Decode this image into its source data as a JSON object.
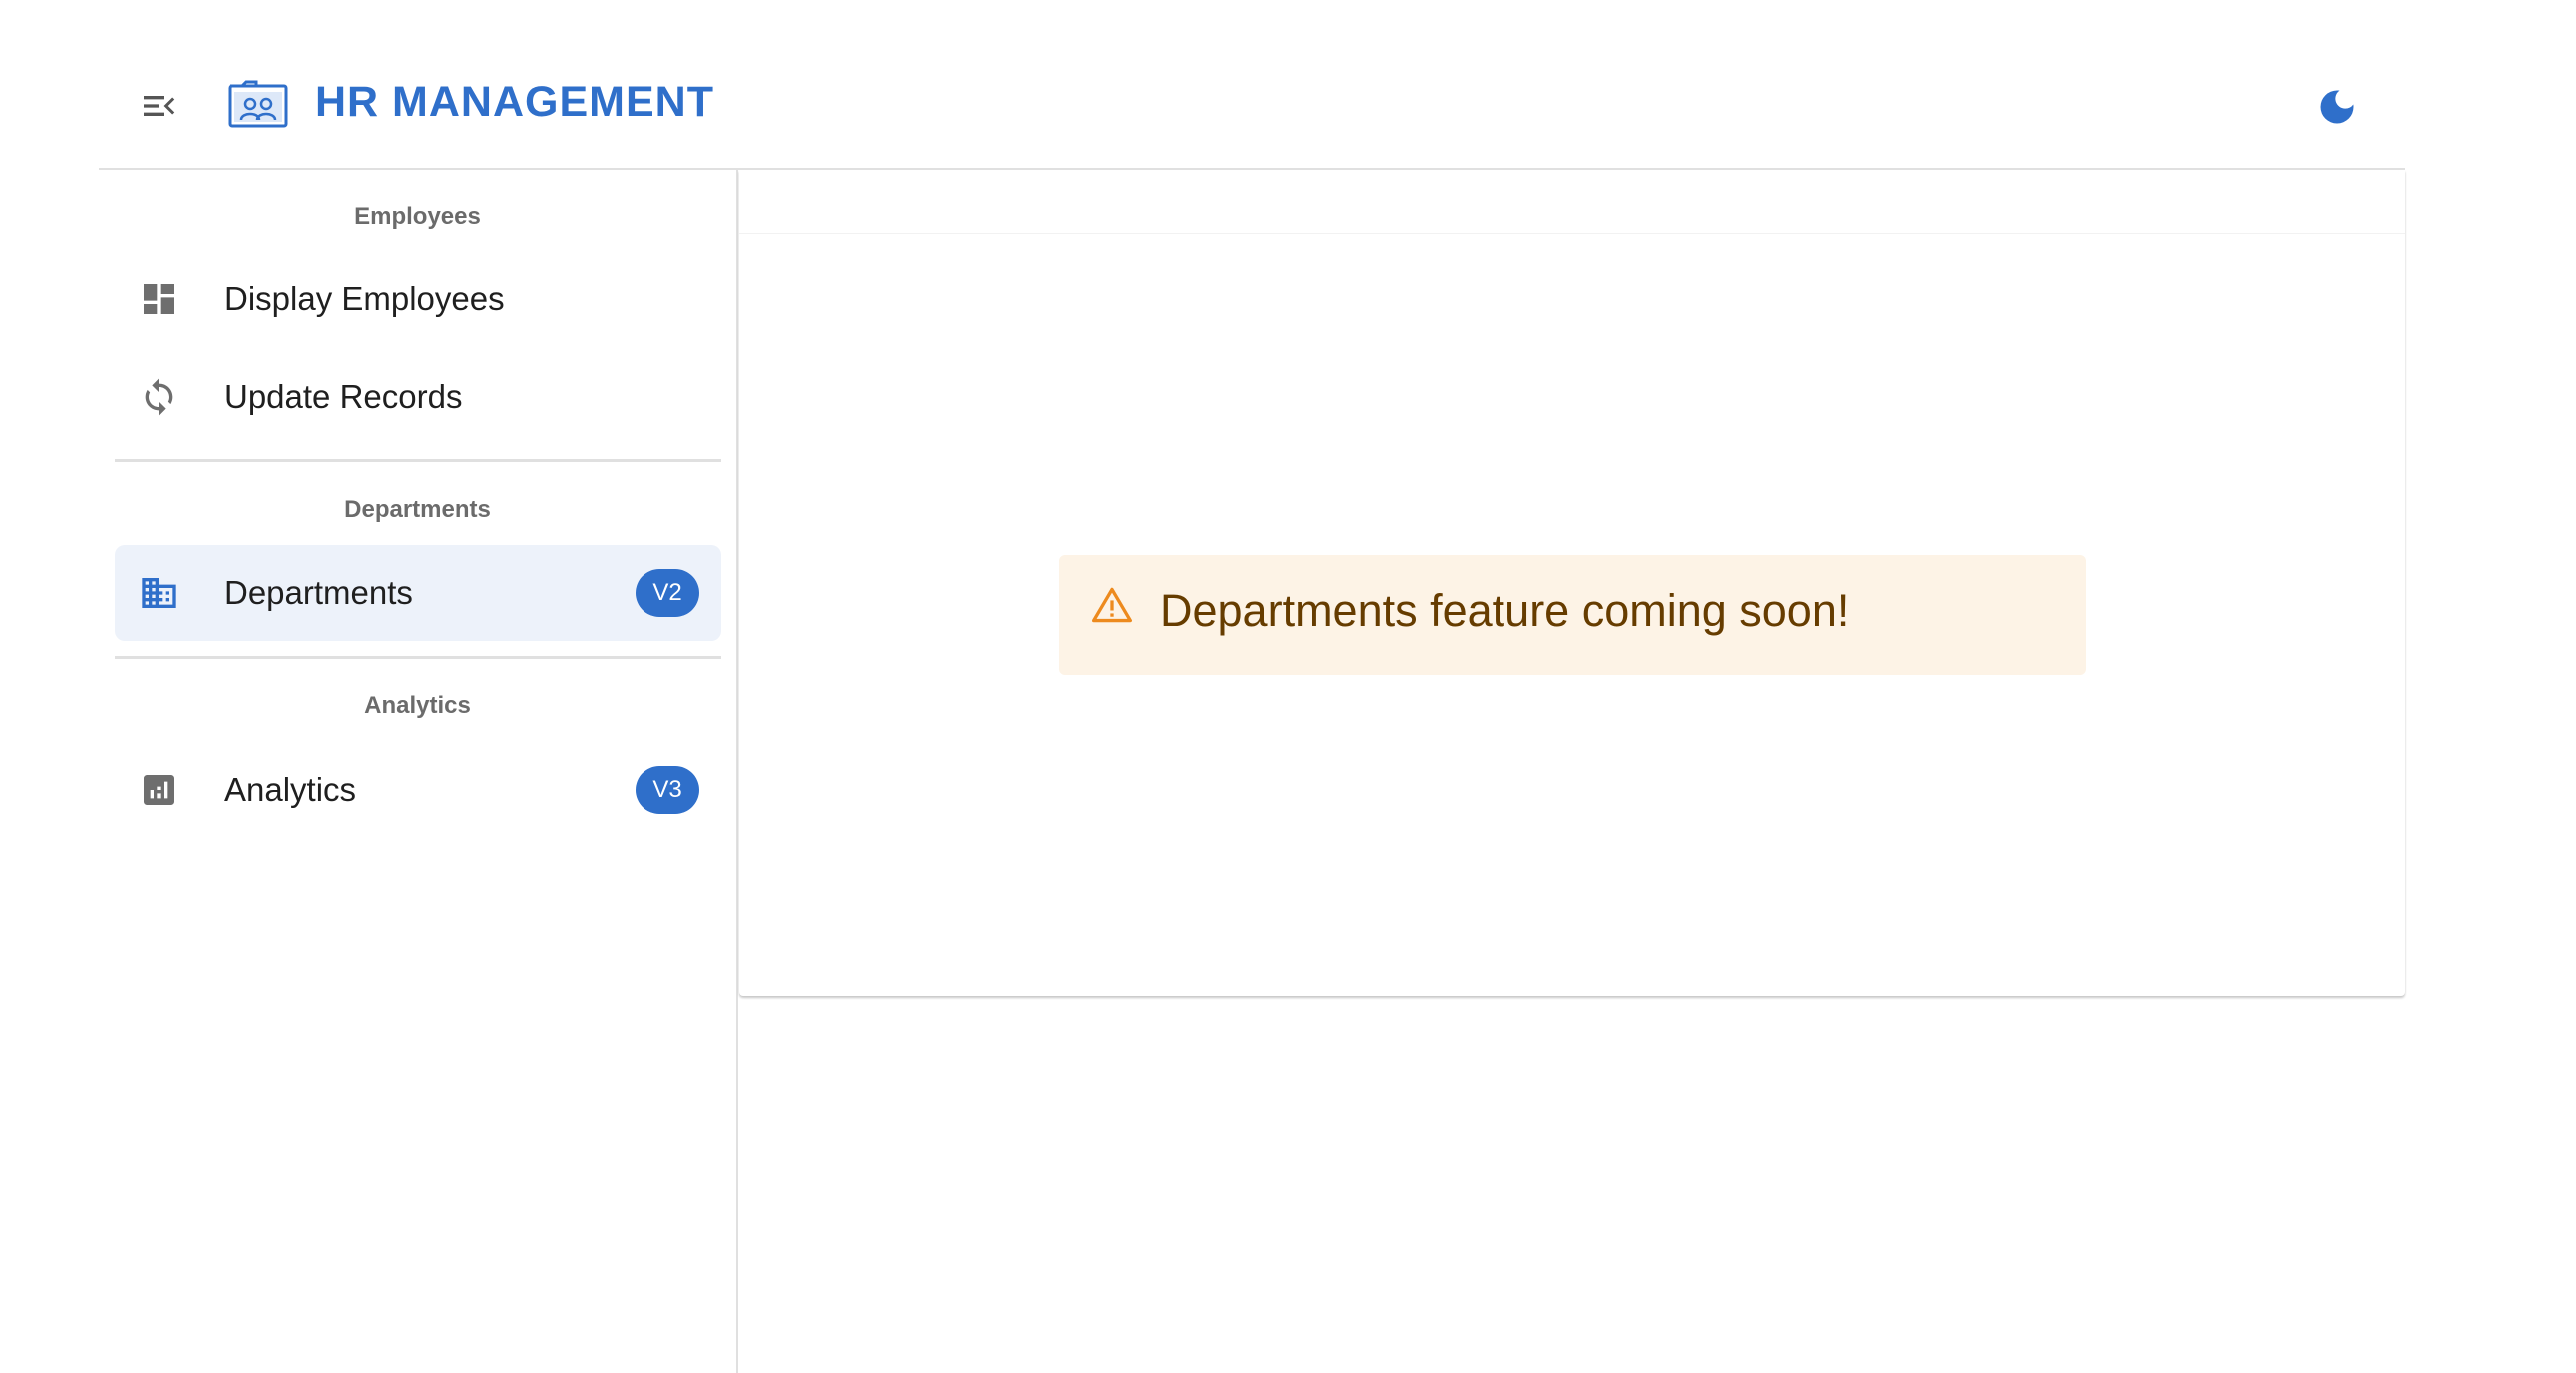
{
  "header": {
    "title": "HR MANAGEMENT",
    "menu_icon": "menu-collapse-icon",
    "logo_icon": "hr-logo-icon",
    "theme_icon": "moon-icon",
    "brand_color": "#2f6fca"
  },
  "sidebar": {
    "sections": [
      {
        "header": "Employees",
        "items": [
          {
            "label": "Display Employees",
            "icon": "dashboard-icon",
            "selected": false
          },
          {
            "label": "Update Records",
            "icon": "sync-icon",
            "selected": false
          }
        ]
      },
      {
        "header": "Departments",
        "items": [
          {
            "label": "Departments",
            "icon": "building-icon",
            "badge": "V2",
            "selected": true
          }
        ]
      },
      {
        "header": "Analytics",
        "items": [
          {
            "label": "Analytics",
            "icon": "bar-chart-icon",
            "badge": "V3",
            "selected": false
          }
        ]
      }
    ]
  },
  "main": {
    "alert": {
      "severity": "warning",
      "icon": "warning-icon",
      "message": "Departments feature coming soon!",
      "background": "#fdf3e6",
      "icon_color": "#ed8a1e",
      "text_color": "#663c00"
    }
  }
}
